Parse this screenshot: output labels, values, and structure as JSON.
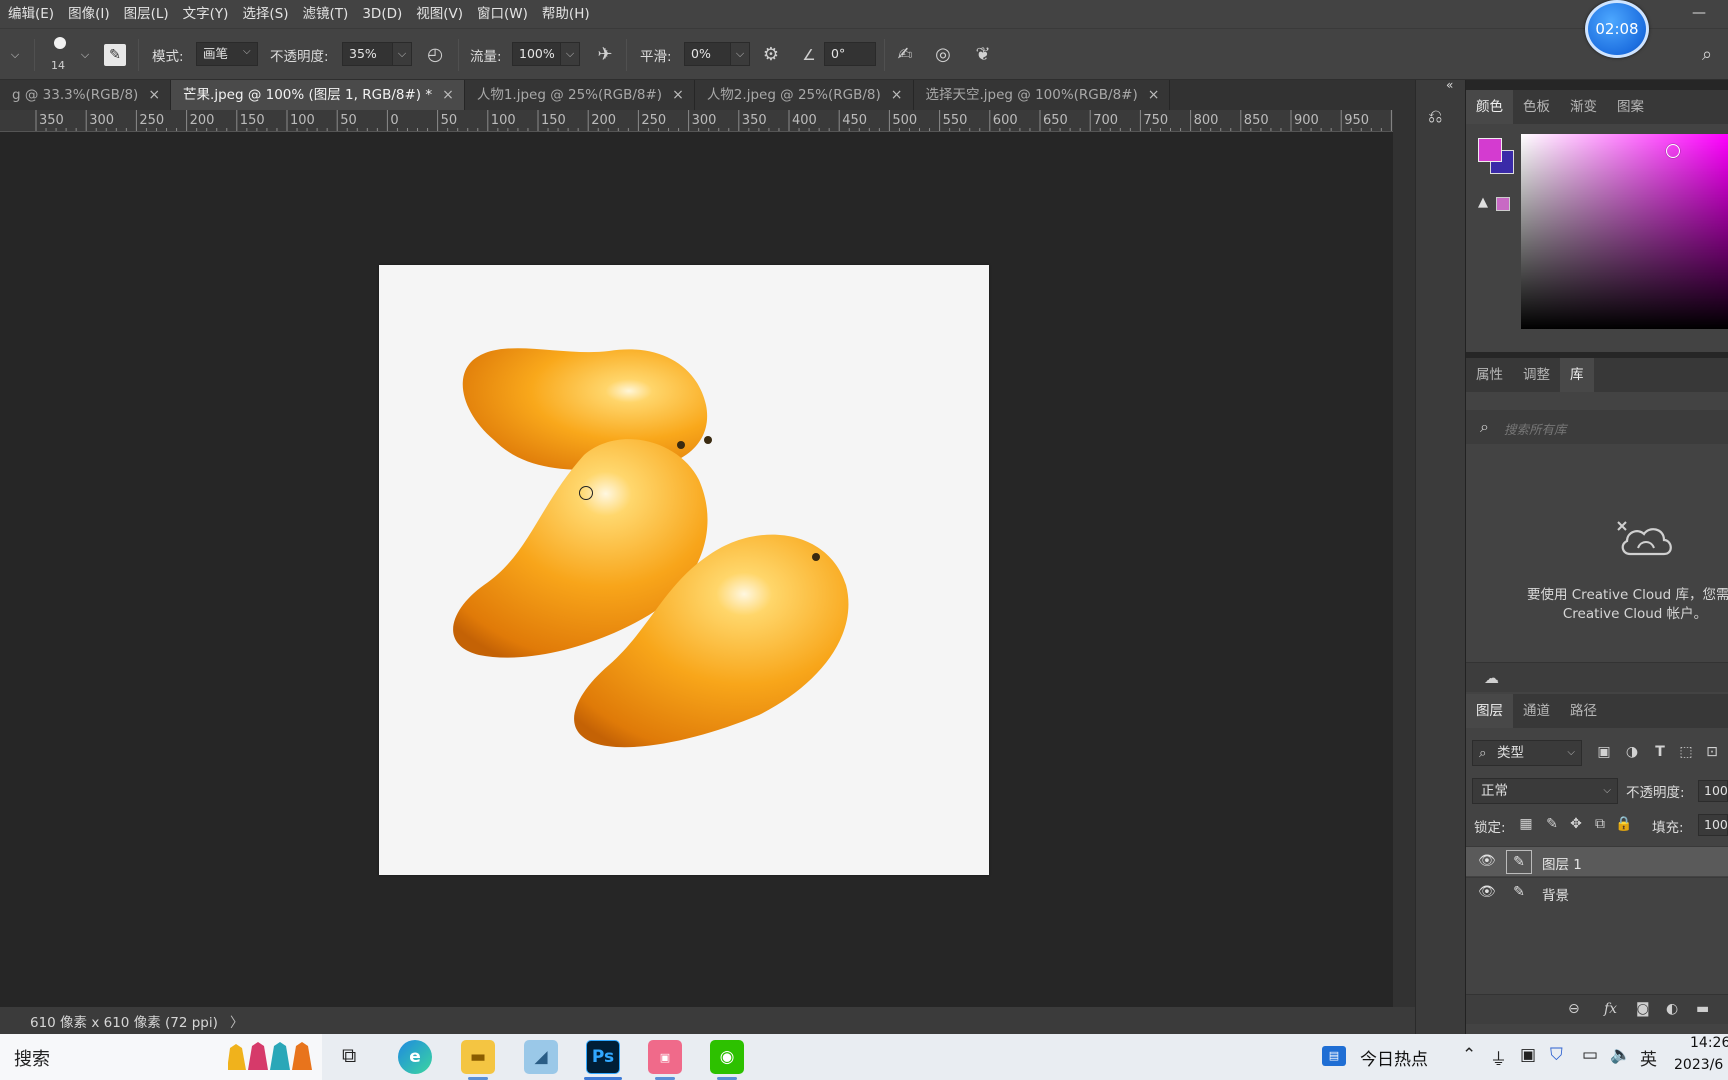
{
  "menu": [
    "编辑(E)",
    "图像(I)",
    "图层(L)",
    "文字(Y)",
    "选择(S)",
    "滤镜(T)",
    "3D(D)",
    "视图(V)",
    "窗口(W)",
    "帮助(H)"
  ],
  "timer": "02:08",
  "options": {
    "brush_size": "14",
    "mode_label": "模式:",
    "mode_value": "画笔",
    "opacity_label": "不透明度:",
    "opacity_value": "35%",
    "flow_label": "流量:",
    "flow_value": "100%",
    "smooth_label": "平滑:",
    "smooth_value": "0%",
    "angle_value": "0°"
  },
  "tabs": [
    {
      "label": "g @ 33.3%(RGB/8)",
      "active": false
    },
    {
      "label": "芒果.jpeg @ 100% (图层 1, RGB/8#) *",
      "active": true
    },
    {
      "label": "人物1.jpeg @ 25%(RGB/8#)",
      "active": false
    },
    {
      "label": "人物2.jpeg @ 25%(RGB/8)",
      "active": false
    },
    {
      "label": "选择天空.jpeg @ 100%(RGB/8#)",
      "active": false
    }
  ],
  "ruler": [
    "350",
    "300",
    "250",
    "200",
    "150",
    "100",
    "50",
    "0",
    "50",
    "100",
    "150",
    "200",
    "250",
    "300",
    "350",
    "400",
    "450",
    "500",
    "550",
    "600",
    "650",
    "700",
    "750",
    "800",
    "850",
    "900",
    "950",
    "100"
  ],
  "status": "610 像素 x 610 像素 (72 ppi)",
  "color_panel": {
    "tabs": [
      "颜色",
      "色板",
      "渐变",
      "图案"
    ],
    "foreground": "#d43bd0",
    "background": "#3a2aa8"
  },
  "props_panel": {
    "tabs": [
      "属性",
      "调整",
      "库"
    ],
    "search_placeholder": "搜索所有库",
    "message_line1": "要使用 Creative Cloud 库，您需要",
    "message_line2": "Creative Cloud 帐户。"
  },
  "layers_panel": {
    "tabs": [
      "图层",
      "通道",
      "路径"
    ],
    "filter_value": "类型",
    "blend_mode": "正常",
    "opacity_label": "不透明度:",
    "opacity_value": "100%",
    "lock_label": "锁定:",
    "fill_label": "填充:",
    "fill_value": "100%",
    "layers": [
      {
        "name": "图层 1",
        "selected": true
      },
      {
        "name": "背景",
        "selected": false
      }
    ]
  },
  "taskbar": {
    "search": "搜索",
    "news": "今日热点",
    "lang": "英",
    "time": "14:26",
    "date": "2023/6"
  }
}
